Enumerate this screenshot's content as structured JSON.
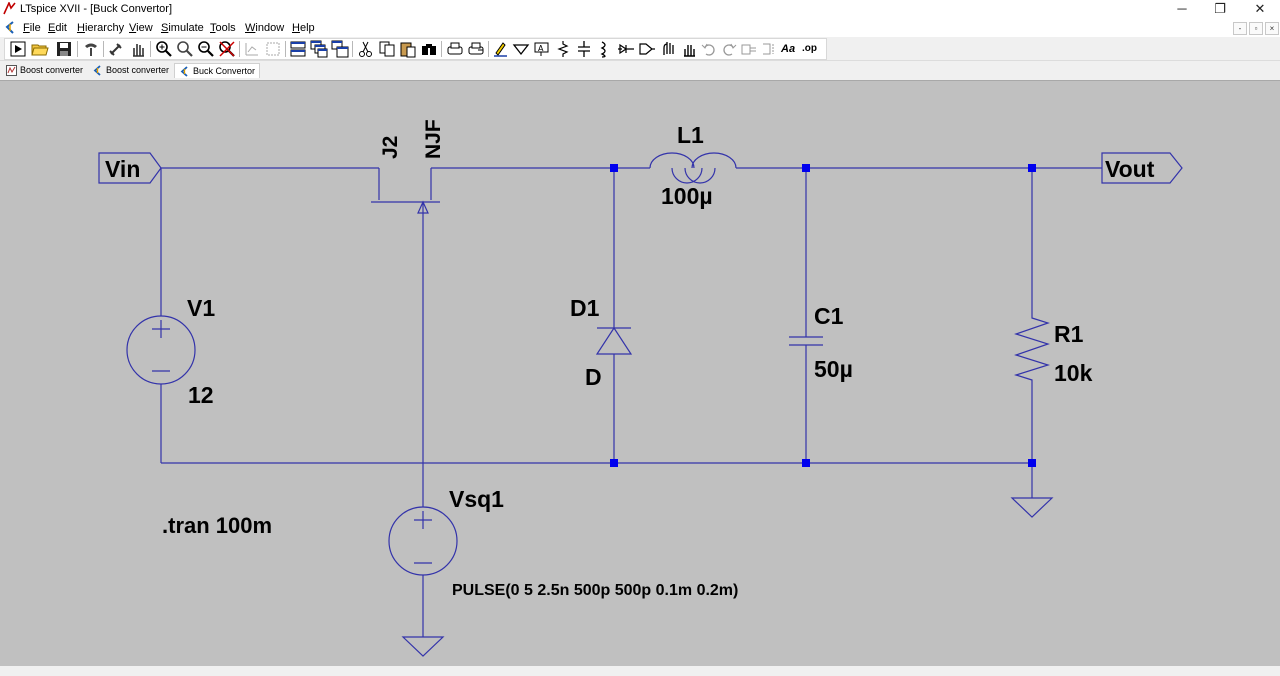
{
  "window": {
    "title": "LTspice XVII - [Buck Convertor]",
    "minimize": "─",
    "restore": "❐",
    "close": "✕"
  },
  "menu": {
    "items": [
      {
        "key": "F",
        "rest": "ile"
      },
      {
        "key": "E",
        "rest": "dit"
      },
      {
        "key": "H",
        "rest": "ierarchy"
      },
      {
        "key": "V",
        "rest": "iew"
      },
      {
        "key": "S",
        "rest": "imulate"
      },
      {
        "key": "T",
        "rest": "ools"
      },
      {
        "key": "W",
        "rest": "indow"
      },
      {
        "key": "H",
        "rest": "elp"
      }
    ],
    "mdi": {
      "minimize": "-",
      "restore": "▫",
      "close": "×"
    }
  },
  "toolbar": {
    "icons": [
      "run-icon",
      "open-icon",
      "save-icon",
      "control-panel-icon",
      "halt-icon",
      "pan-icon",
      "zoom-in-icon",
      "zoom-fit-icon",
      "zoom-out-icon",
      "cancel-zoom-icon",
      "autorange-icon",
      "zoom-area-icon",
      "tile-horizontal-icon",
      "cascade-icon",
      "tile-vertical-icon",
      "cut-icon",
      "copy-icon",
      "paste-icon",
      "find-icon",
      "print-icon",
      "print-setup-icon",
      "draw-wire-icon",
      "ground-icon",
      "label-net-icon",
      "resistor-icon",
      "capacitor-icon",
      "inductor-icon",
      "diode-icon",
      "component-icon",
      "rotate-icon",
      "mirror-icon",
      "undo-icon",
      "redo-icon",
      "text-icon",
      "spice-directive-icon"
    ],
    "text_label": "Aa",
    "op_label": ".op"
  },
  "tabs": [
    {
      "label": "Boost converter",
      "active": false
    },
    {
      "label": "Boost converter",
      "active": false
    },
    {
      "label": "Buck Convertor",
      "active": true
    }
  ],
  "schematic": {
    "wire_color": "#3333aa",
    "junction_color": "#0000ee",
    "labels": {
      "vin": "Vin",
      "vout": "Vout",
      "j2_name": "J2",
      "j2_model": "NJF",
      "l1_name": "L1",
      "l1_value": "100µ",
      "v1_name": "V1",
      "v1_value": "12",
      "d1_name": "D1",
      "d1_model": "D",
      "c1_name": "C1",
      "c1_value": "50µ",
      "r1_name": "R1",
      "r1_value": "10k",
      "vsq1_name": "Vsq1",
      "vsq1_value": "PULSE(0 5 2.5n 500p 500p 0.1m 0.2m)",
      "tran_directive": ".tran 100m"
    }
  }
}
